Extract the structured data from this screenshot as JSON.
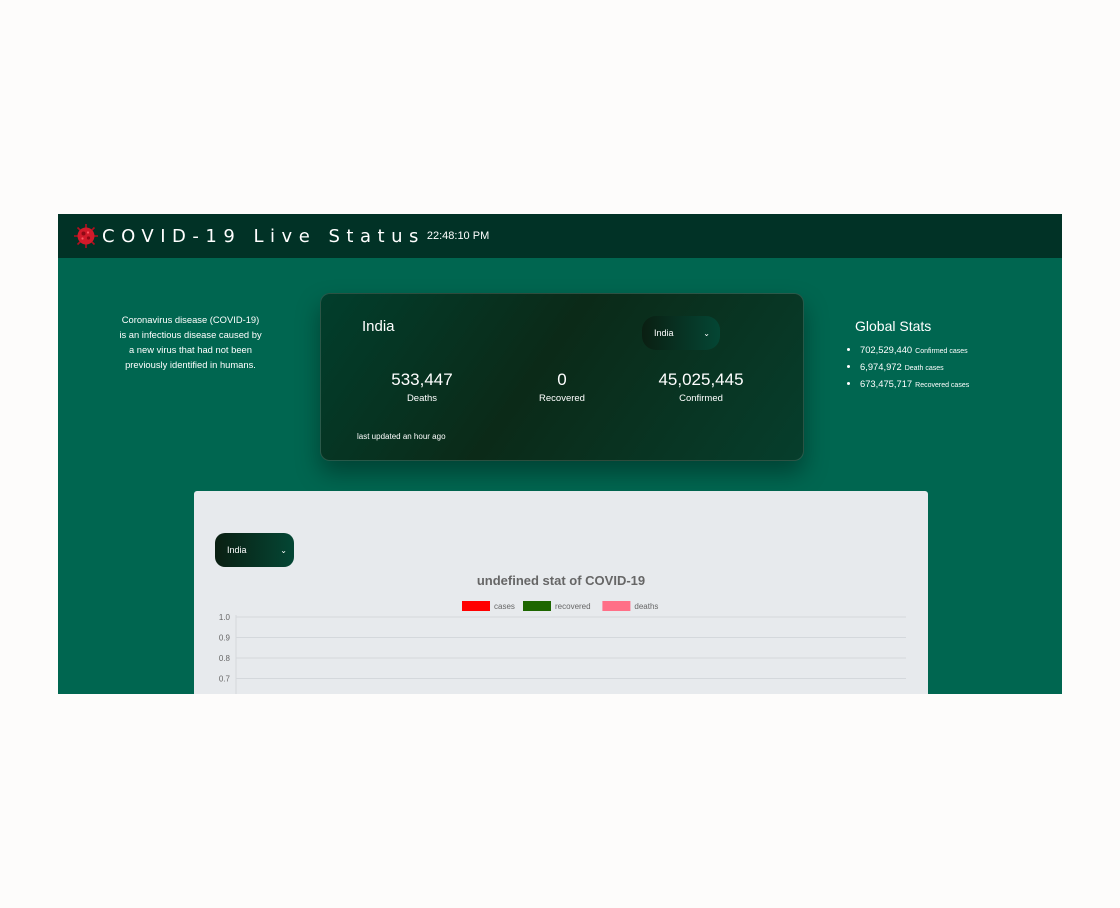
{
  "header": {
    "title": "COVID-19 Live Status",
    "time": "22:48:10 PM"
  },
  "intro_text": "Coronavirus disease (COVID-19) is an infectious disease caused by a new virus that had not been previously identified in humans.",
  "country_card": {
    "country": "India",
    "selected_country": "India",
    "stats": [
      {
        "value": "533,447",
        "label": "Deaths"
      },
      {
        "value": "0",
        "label": "Recovered"
      },
      {
        "value": "45,025,445",
        "label": "Confirmed"
      }
    ],
    "last_updated": "last updated an hour ago"
  },
  "global_stats": {
    "title": "Global Stats",
    "items": [
      {
        "value": "702,529,440",
        "label": "Confirmed cases"
      },
      {
        "value": "6,974,972",
        "label": "Death cases"
      },
      {
        "value": "673,475,717",
        "label": "Recovered cases"
      }
    ]
  },
  "chart_panel": {
    "selected_country": "India"
  },
  "colors": {
    "page_bg": "#006650",
    "navbar_bg": "#013226",
    "cases": "#ff0000",
    "recovered": "#1d6600",
    "deaths": "#ff6f87"
  },
  "chart_data": {
    "type": "line",
    "title": "undefined stat of COVID-19",
    "series": [
      {
        "name": "cases",
        "color": "#ff0000",
        "values": []
      },
      {
        "name": "recovered",
        "color": "#1d6600",
        "values": []
      },
      {
        "name": "deaths",
        "color": "#ff6f87",
        "values": []
      }
    ],
    "yticks": [
      "1.0",
      "0.9",
      "0.8",
      "0.7"
    ],
    "ylim": [
      0,
      1
    ],
    "grid": true,
    "legend": "top"
  }
}
